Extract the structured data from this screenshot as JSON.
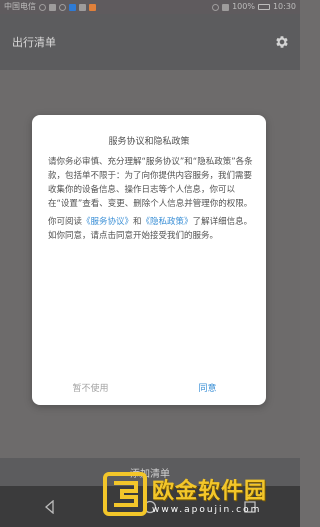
{
  "status_bar": {
    "carrier": "中国电信",
    "battery": "100%",
    "time": "10:30"
  },
  "app_bar": {
    "title": "出行清单",
    "settings_icon": "gear-icon"
  },
  "dialog": {
    "title": "服务协议和隐私政策",
    "paragraph1": "请你务必审慎、充分理解“服务协议”和“隐私政策”各条款，包括单不限于：为了向你提供内容服务，我们需要收集你的设备信息、操作日志等个人信息，你可以在“设置”查看、变更、删除个人信息并管理你的权限。",
    "paragraph2_prefix": "你可阅读",
    "service_link": "《服务协议》",
    "and_text": "和",
    "privacy_link": "《隐私政策》",
    "paragraph2_suffix": "了解详细信息。如你同意，请点击同意开始接受我们的服务。",
    "reject_label": "暂不使用",
    "agree_label": "同意"
  },
  "bottom_button": {
    "label": "添加清单"
  },
  "watermark": {
    "name": "欧金软件园",
    "url": "www.apoujin.com"
  },
  "colors": {
    "link": "#3a8fd6",
    "overlay": "#6d6b6b",
    "dialog_bg": "#ffffff"
  }
}
